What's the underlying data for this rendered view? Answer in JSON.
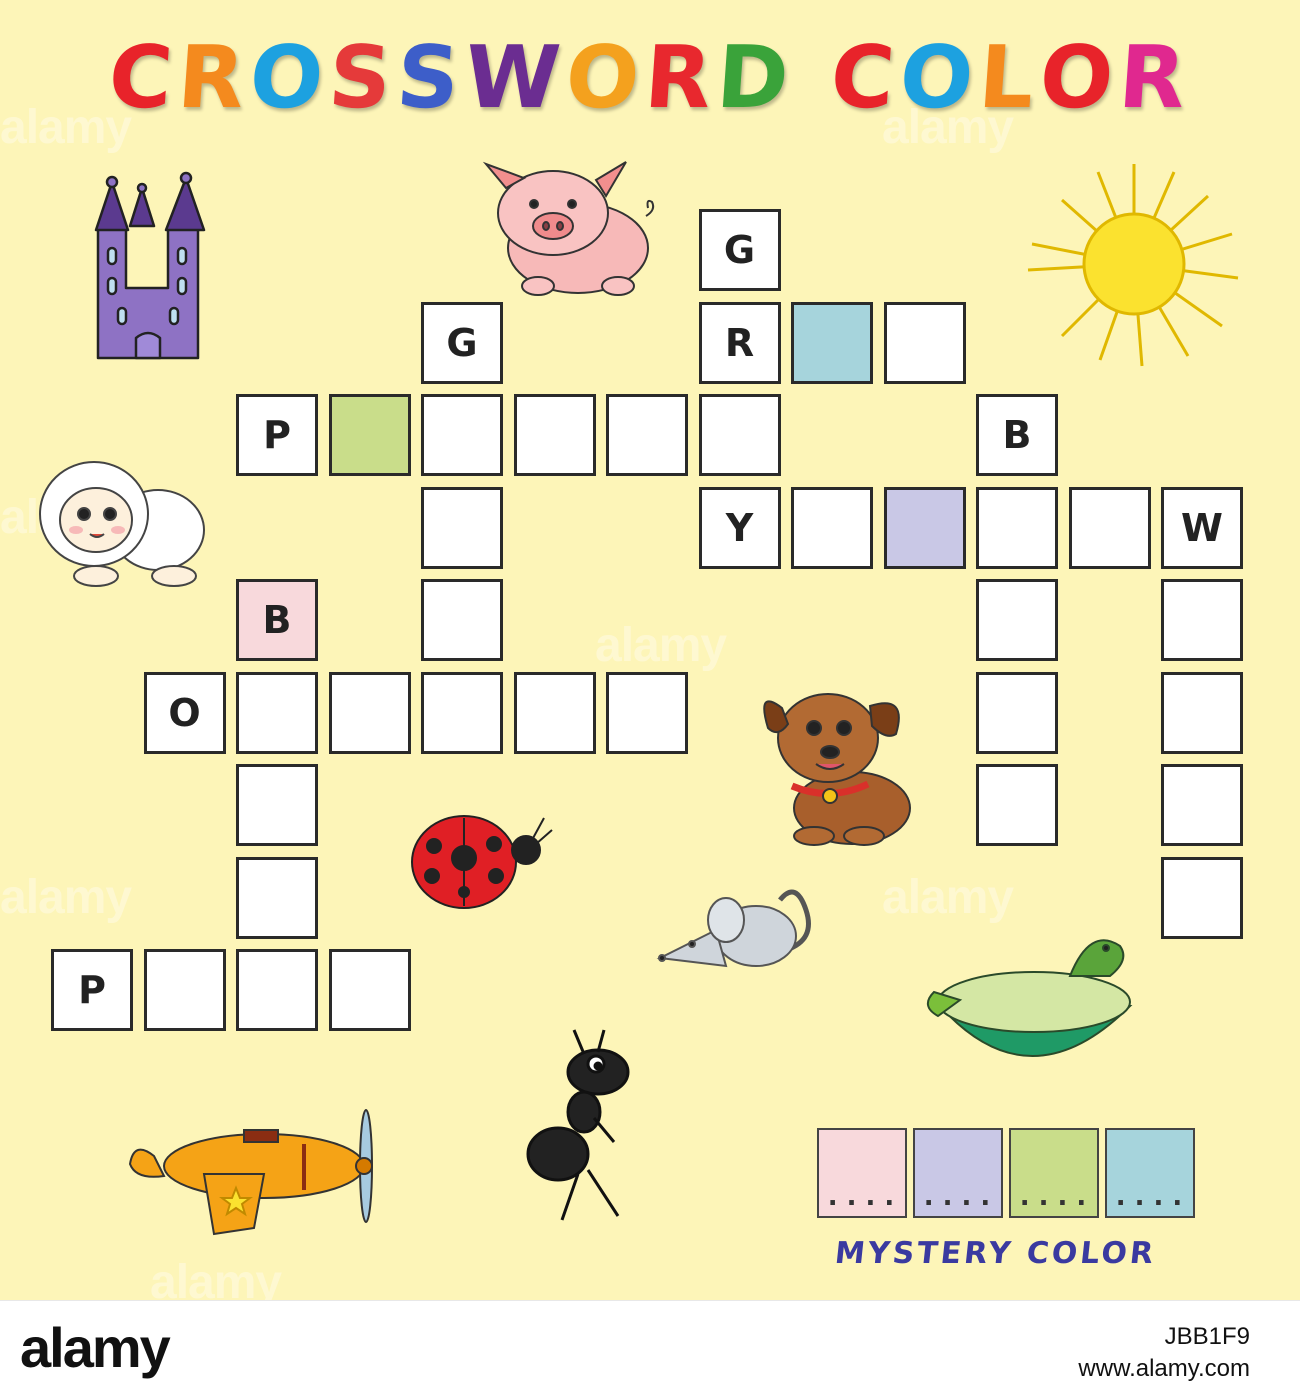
{
  "title": {
    "letters": [
      {
        "ch": "C",
        "color": "#e8232a"
      },
      {
        "ch": "R",
        "color": "#f48a1e"
      },
      {
        "ch": "O",
        "color": "#1da1e0"
      },
      {
        "ch": "S",
        "color": "#e53a3a"
      },
      {
        "ch": "S",
        "color": "#3d5ec9"
      },
      {
        "ch": "W",
        "color": "#6b2d91"
      },
      {
        "ch": "O",
        "color": "#f4a11e"
      },
      {
        "ch": "R",
        "color": "#e8282e"
      },
      {
        "ch": "D",
        "color": "#3aa33a"
      },
      {
        "ch": " ",
        "color": "#000000"
      },
      {
        "ch": "C",
        "color": "#e8232a"
      },
      {
        "ch": "O",
        "color": "#1da1e0"
      },
      {
        "ch": "L",
        "color": "#f48a1e"
      },
      {
        "ch": "O",
        "color": "#e8232a"
      },
      {
        "ch": "R",
        "color": "#e0288f"
      }
    ]
  },
  "cells": [
    {
      "r": 0,
      "c": 7,
      "letter": "G",
      "fill": "#ffffff"
    },
    {
      "r": 1,
      "c": 4,
      "letter": "G",
      "fill": "#ffffff"
    },
    {
      "r": 1,
      "c": 7,
      "letter": "R",
      "fill": "#ffffff"
    },
    {
      "r": 1,
      "c": 8,
      "letter": "",
      "fill": "#a6d4dc"
    },
    {
      "r": 1,
      "c": 9,
      "letter": "",
      "fill": "#ffffff"
    },
    {
      "r": 2,
      "c": 2,
      "letter": "P",
      "fill": "#ffffff"
    },
    {
      "r": 2,
      "c": 3,
      "letter": "",
      "fill": "#c9dd8a"
    },
    {
      "r": 2,
      "c": 4,
      "letter": "",
      "fill": "#ffffff"
    },
    {
      "r": 2,
      "c": 5,
      "letter": "",
      "fill": "#ffffff"
    },
    {
      "r": 2,
      "c": 6,
      "letter": "",
      "fill": "#ffffff"
    },
    {
      "r": 2,
      "c": 7,
      "letter": "",
      "fill": "#ffffff"
    },
    {
      "r": 2,
      "c": 10,
      "letter": "B",
      "fill": "#ffffff"
    },
    {
      "r": 3,
      "c": 4,
      "letter": "",
      "fill": "#ffffff"
    },
    {
      "r": 3,
      "c": 7,
      "letter": "Y",
      "fill": "#ffffff"
    },
    {
      "r": 3,
      "c": 8,
      "letter": "",
      "fill": "#ffffff"
    },
    {
      "r": 3,
      "c": 9,
      "letter": "",
      "fill": "#c9c8e6"
    },
    {
      "r": 3,
      "c": 10,
      "letter": "",
      "fill": "#ffffff"
    },
    {
      "r": 3,
      "c": 11,
      "letter": "",
      "fill": "#ffffff"
    },
    {
      "r": 3,
      "c": 12,
      "letter": "W",
      "fill": "#ffffff"
    },
    {
      "r": 4,
      "c": 2,
      "letter": "B",
      "fill": "#f8d9dc"
    },
    {
      "r": 4,
      "c": 4,
      "letter": "",
      "fill": "#ffffff"
    },
    {
      "r": 4,
      "c": 10,
      "letter": "",
      "fill": "#ffffff"
    },
    {
      "r": 4,
      "c": 12,
      "letter": "",
      "fill": "#ffffff"
    },
    {
      "r": 5,
      "c": 1,
      "letter": "O",
      "fill": "#ffffff"
    },
    {
      "r": 5,
      "c": 2,
      "letter": "",
      "fill": "#ffffff"
    },
    {
      "r": 5,
      "c": 3,
      "letter": "",
      "fill": "#ffffff"
    },
    {
      "r": 5,
      "c": 4,
      "letter": "",
      "fill": "#ffffff"
    },
    {
      "r": 5,
      "c": 5,
      "letter": "",
      "fill": "#ffffff"
    },
    {
      "r": 5,
      "c": 6,
      "letter": "",
      "fill": "#ffffff"
    },
    {
      "r": 5,
      "c": 10,
      "letter": "",
      "fill": "#ffffff"
    },
    {
      "r": 5,
      "c": 12,
      "letter": "",
      "fill": "#ffffff"
    },
    {
      "r": 6,
      "c": 2,
      "letter": "",
      "fill": "#ffffff"
    },
    {
      "r": 6,
      "c": 10,
      "letter": "",
      "fill": "#ffffff"
    },
    {
      "r": 6,
      "c": 12,
      "letter": "",
      "fill": "#ffffff"
    },
    {
      "r": 7,
      "c": 2,
      "letter": "",
      "fill": "#ffffff"
    },
    {
      "r": 7,
      "c": 12,
      "letter": "",
      "fill": "#ffffff"
    },
    {
      "r": 8,
      "c": 0,
      "letter": "P",
      "fill": "#ffffff"
    },
    {
      "r": 8,
      "c": 1,
      "letter": "",
      "fill": "#ffffff"
    },
    {
      "r": 8,
      "c": 2,
      "letter": "",
      "fill": "#ffffff"
    },
    {
      "r": 8,
      "c": 3,
      "letter": "",
      "fill": "#ffffff"
    }
  ],
  "mystery": {
    "boxes": [
      {
        "fill": "#f8d9dc",
        "dots": "...."
      },
      {
        "fill": "#c9c8e6",
        "dots": "...."
      },
      {
        "fill": "#c9dd8a",
        "dots": "...."
      },
      {
        "fill": "#a6d4dc",
        "dots": "...."
      }
    ],
    "label": "MYSTERY COLOR"
  },
  "illustrations": [
    "castle",
    "pig",
    "sun",
    "sheep",
    "dog",
    "ladybug",
    "mouse",
    "turtle",
    "airplane",
    "ant"
  ],
  "watermark": {
    "text": "alamy"
  },
  "footer": {
    "logo": "alamy",
    "stock_id": "JBB1F9",
    "site": "www.alamy.com"
  }
}
